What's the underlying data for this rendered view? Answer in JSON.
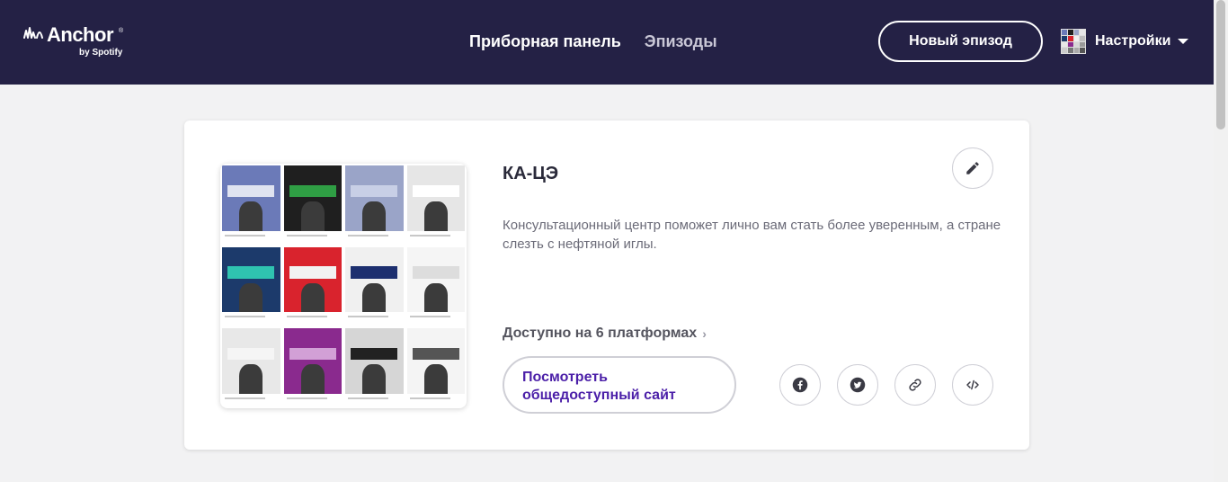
{
  "header": {
    "logo_text": "Anchor",
    "logo_reg": "®",
    "logo_sub": "by Spotify",
    "nav": [
      {
        "label": "Приборная панель",
        "active": true
      },
      {
        "label": "Эпизоды",
        "active": false
      }
    ],
    "new_episode_label": "Новый эпизод",
    "settings_label": "Настройки",
    "background": "#242145"
  },
  "podcast": {
    "title": "КА-ЦЭ",
    "description": "Консультационный центр поможет лично вам стать более уверенным, а стране слезть с нефтяной иглы.",
    "platforms_label": "Доступно на 6 платформах",
    "public_site_label": "Посмотреть общедоступный сайт",
    "cover_books": [
      {
        "bg": "#6b7ab8",
        "band": "#dfe3f0"
      },
      {
        "bg": "#1f1f1f",
        "band": "#2f9e44"
      },
      {
        "bg": "#9aa4c8",
        "band": "#c8cfe6"
      },
      {
        "bg": "#e6e6e6",
        "band": "#ffffff"
      },
      {
        "bg": "#1c3a6b",
        "band": "#2fc3b0"
      },
      {
        "bg": "#d9232d",
        "band": "#f2f2f2"
      },
      {
        "bg": "#f0f0f0",
        "band": "#1d2f6f"
      },
      {
        "bg": "#f5f5f5",
        "band": "#dddddd"
      },
      {
        "bg": "#e8e8e8",
        "band": "#f5f5f5"
      },
      {
        "bg": "#8a2a8e",
        "band": "#d2a0d6"
      },
      {
        "bg": "#d6d6d6",
        "band": "#222222"
      },
      {
        "bg": "#f4f4f4",
        "band": "#555555"
      }
    ]
  },
  "icons": {
    "edit": "pencil-icon",
    "facebook": "facebook-icon",
    "twitter": "twitter-icon",
    "link": "link-icon",
    "embed": "embed-icon"
  },
  "colors": {
    "accent": "#4b1fa8",
    "page_bg": "#f2f2f3"
  }
}
